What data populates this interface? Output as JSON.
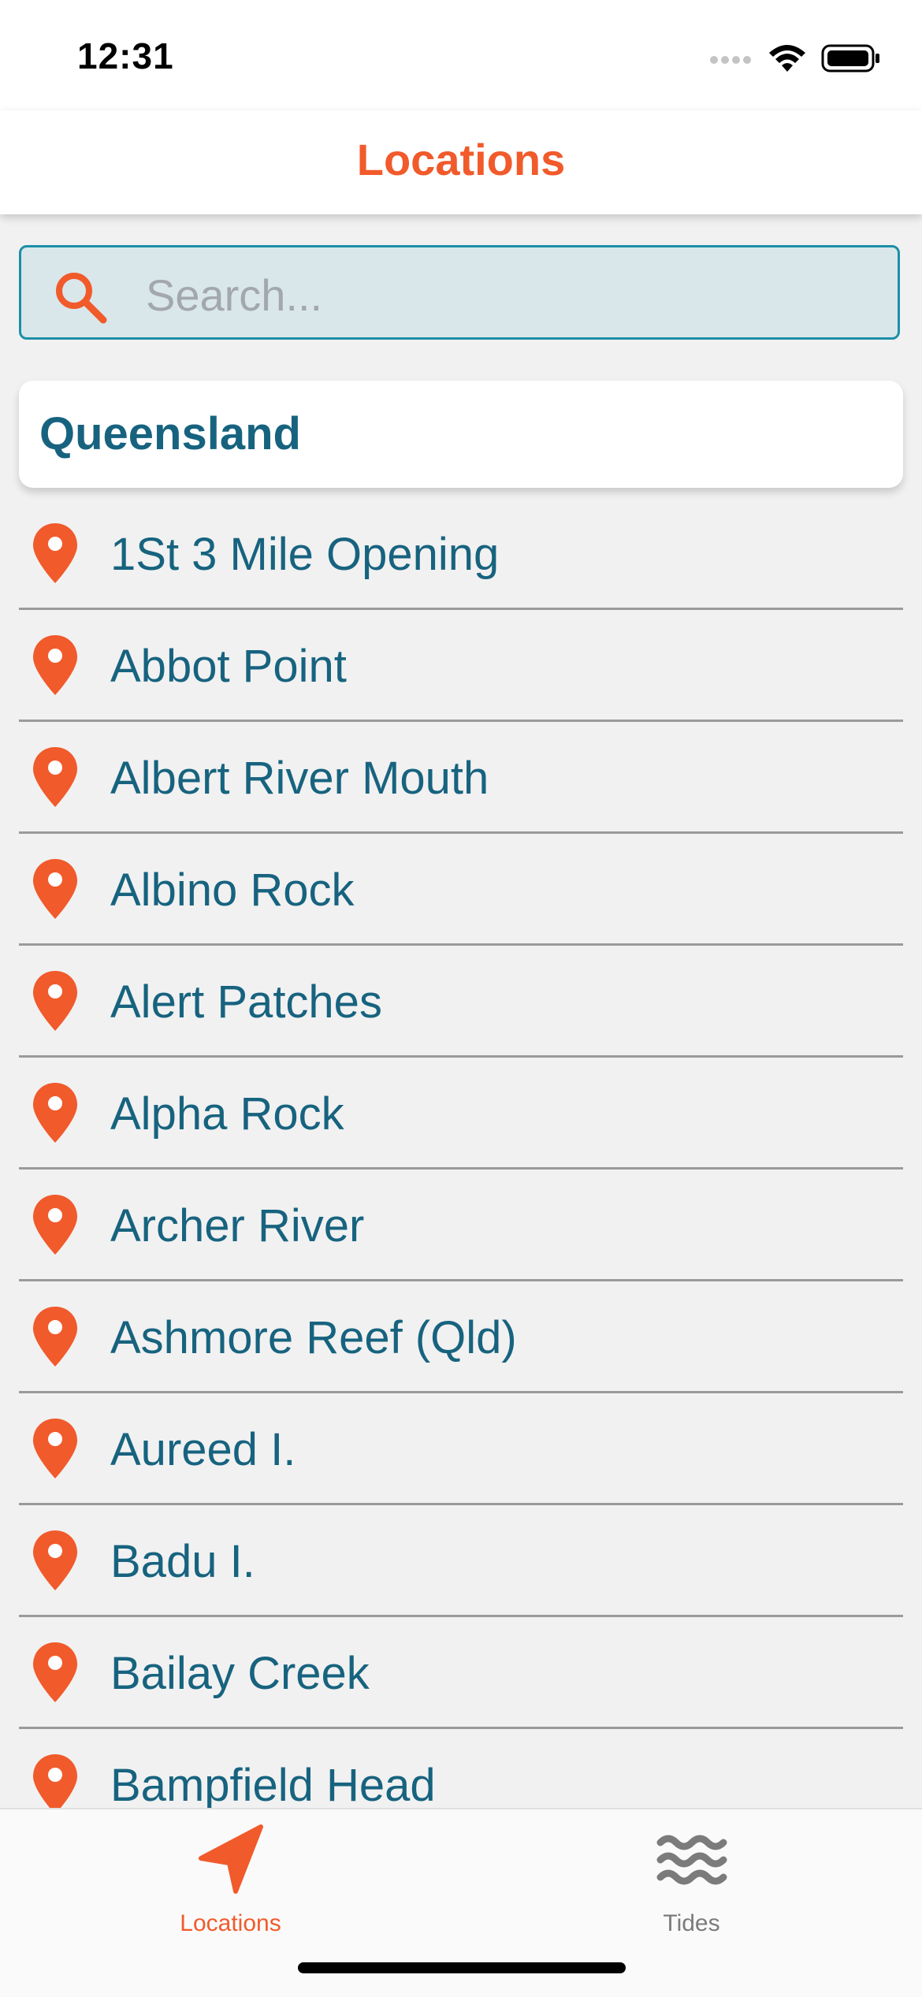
{
  "status_bar": {
    "time": "12:31"
  },
  "nav": {
    "title": "Locations"
  },
  "search": {
    "placeholder": "Search..."
  },
  "section": {
    "title": "Queensland"
  },
  "locations": [
    "1St 3 Mile Opening",
    "Abbot Point",
    "Albert River Mouth",
    "Albino Rock",
    "Alert Patches",
    "Alpha Rock",
    "Archer River",
    "Ashmore Reef (Qld)",
    "Aureed I.",
    "Badu I.",
    "Bailay Creek",
    "Bampfield Head"
  ],
  "tabs": [
    {
      "label": "Locations",
      "icon": "navigation-arrow-icon",
      "active": true
    },
    {
      "label": "Tides",
      "icon": "waves-icon",
      "active": false
    }
  ],
  "colors": {
    "accent": "#f15a2b",
    "text_primary": "#17637f",
    "search_bg": "#d9e7ea",
    "search_border": "#1d8fa7",
    "tab_inactive": "#7b7b7b"
  }
}
